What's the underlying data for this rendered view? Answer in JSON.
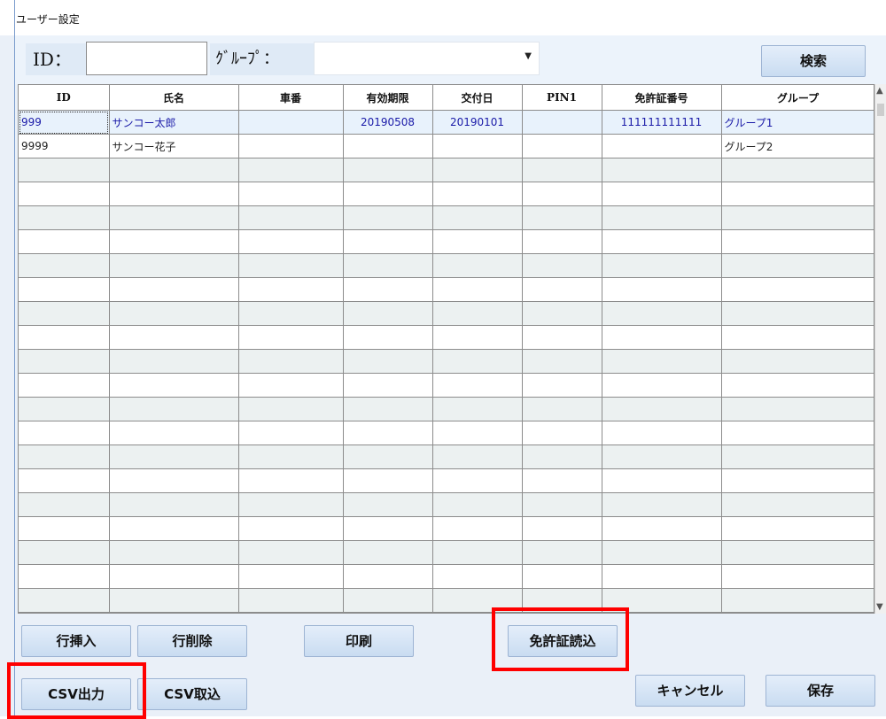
{
  "window": {
    "title": "ユーザー設定"
  },
  "search": {
    "id_label": "ID：",
    "id_value": "",
    "group_label": "ｸﾞﾙｰﾌﾟ：",
    "group_value": "",
    "search_button": "検索"
  },
  "grid": {
    "columns": [
      "ID",
      "氏名",
      "車番",
      "有効期限",
      "交付日",
      "PIN1",
      "免許証番号",
      "グループ"
    ],
    "rows": [
      [
        "999",
        "サンコー太郎",
        "",
        "20190508",
        "20190101",
        "",
        "111111111111",
        "グループ1"
      ],
      [
        "9999",
        "サンコー花子",
        "",
        "",
        "",
        "",
        "",
        "グループ2"
      ],
      [
        "",
        "",
        "",
        "",
        "",
        "",
        "",
        ""
      ],
      [
        "",
        "",
        "",
        "",
        "",
        "",
        "",
        ""
      ],
      [
        "",
        "",
        "",
        "",
        "",
        "",
        "",
        ""
      ],
      [
        "",
        "",
        "",
        "",
        "",
        "",
        "",
        ""
      ],
      [
        "",
        "",
        "",
        "",
        "",
        "",
        "",
        ""
      ],
      [
        "",
        "",
        "",
        "",
        "",
        "",
        "",
        ""
      ],
      [
        "",
        "",
        "",
        "",
        "",
        "",
        "",
        ""
      ],
      [
        "",
        "",
        "",
        "",
        "",
        "",
        "",
        ""
      ],
      [
        "",
        "",
        "",
        "",
        "",
        "",
        "",
        ""
      ],
      [
        "",
        "",
        "",
        "",
        "",
        "",
        "",
        ""
      ],
      [
        "",
        "",
        "",
        "",
        "",
        "",
        "",
        ""
      ],
      [
        "",
        "",
        "",
        "",
        "",
        "",
        "",
        ""
      ],
      [
        "",
        "",
        "",
        "",
        "",
        "",
        "",
        ""
      ],
      [
        "",
        "",
        "",
        "",
        "",
        "",
        "",
        ""
      ],
      [
        "",
        "",
        "",
        "",
        "",
        "",
        "",
        ""
      ],
      [
        "",
        "",
        "",
        "",
        "",
        "",
        "",
        ""
      ],
      [
        "",
        "",
        "",
        "",
        "",
        "",
        "",
        ""
      ],
      [
        "",
        "",
        "",
        "",
        "",
        "",
        "",
        ""
      ],
      [
        "",
        "",
        "",
        "",
        "",
        "",
        "",
        ""
      ],
      [
        "",
        "",
        "",
        "",
        "",
        "",
        "",
        ""
      ]
    ]
  },
  "buttons": {
    "insert_row": "行挿入",
    "delete_row": "行削除",
    "print": "印刷",
    "read_license": "免許証読込",
    "csv_export": "CSV出力",
    "csv_import": "CSV取込",
    "cancel": "キャンセル",
    "save": "保存"
  },
  "colors": {
    "highlight": "#ff0000",
    "selected_text": "#1a1aa8",
    "alt_row": "#ecf1f1"
  }
}
